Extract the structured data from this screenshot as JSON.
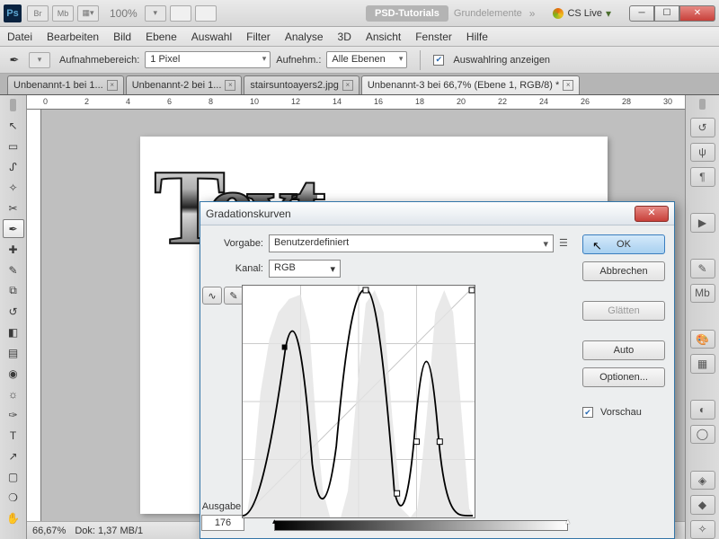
{
  "titlebar": {
    "zoom": "100%",
    "ws_pill": "PSD-Tutorials",
    "ws_text": "Grundelemente",
    "cslive": "CS Live"
  },
  "menu": [
    "Datei",
    "Bearbeiten",
    "Bild",
    "Ebene",
    "Auswahl",
    "Filter",
    "Analyse",
    "3D",
    "Ansicht",
    "Fenster",
    "Hilfe"
  ],
  "optbar": {
    "lbl1": "Aufnahmebereich:",
    "v1": "1 Pixel",
    "lbl2": "Aufnehm.:",
    "v2": "Alle Ebenen",
    "chk": "Auswahlring anzeigen"
  },
  "tabs": [
    {
      "t": "Unbenannt-1 bei 1...",
      "active": false
    },
    {
      "t": "Unbenannt-2 bei 1...",
      "active": false
    },
    {
      "t": "stairsuntoayers2.jpg",
      "active": false
    },
    {
      "t": "Unbenannt-3 bei 66,7% (Ebene 1, RGB/8) *",
      "active": true
    }
  ],
  "ruler_marks": [
    "0",
    "2",
    "4",
    "6",
    "8",
    "10",
    "12",
    "14",
    "16",
    "18",
    "20",
    "22",
    "24",
    "26",
    "28",
    "30"
  ],
  "status": {
    "zoom": "66,67%",
    "doc": "Dok: 1,37 MB/1"
  },
  "dialog": {
    "title": "Gradationskurven",
    "preset_lbl": "Vorgabe:",
    "preset": "Benutzerdefiniert",
    "channel_lbl": "Kanal:",
    "channel": "RGB",
    "output_lbl": "Ausgabe:",
    "output": "176",
    "btn_ok": "OK",
    "btn_cancel": "Abbrechen",
    "btn_smooth": "Glätten",
    "btn_auto": "Auto",
    "btn_opts": "Optionen...",
    "preview": "Vorschau"
  },
  "canvas_text": "Text"
}
